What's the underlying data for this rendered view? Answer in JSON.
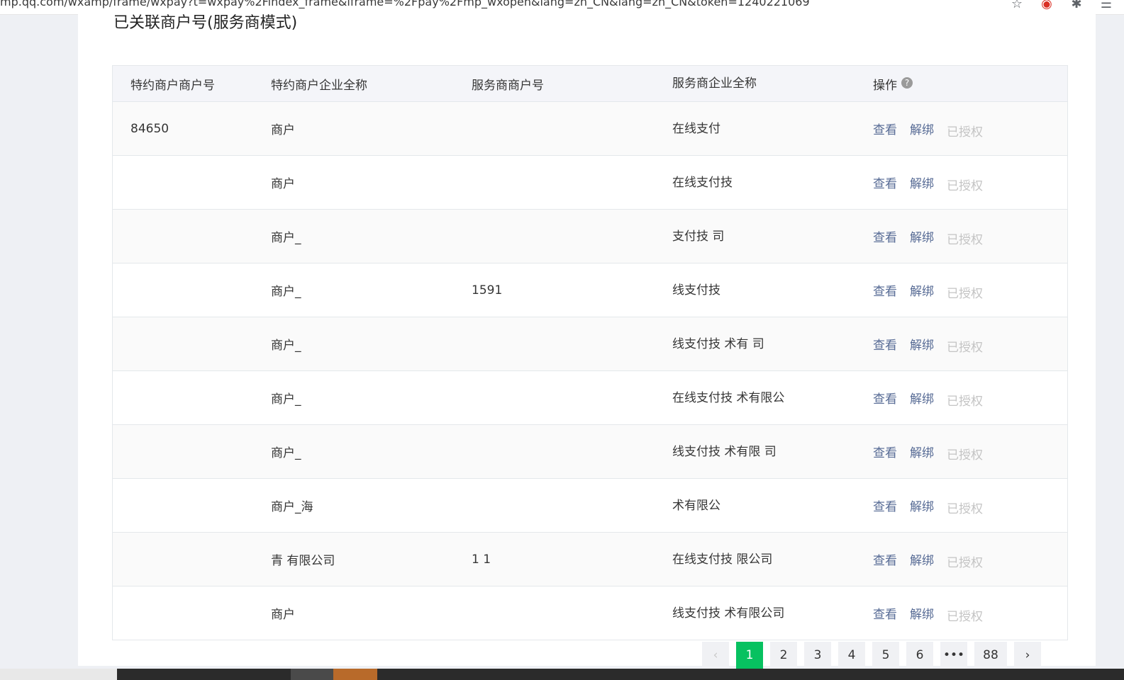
{
  "browser": {
    "url": "mp.qq.com/wxamp/frame/wxpay?t=wxpay%2Findex_frame&iframe=%2Fpay%2Fmp_wxopen&lang=zh_CN&lang=zh_CN&token=1240221069",
    "icons": [
      "star-icon",
      "record-icon",
      "extension-icon",
      "reading-list-icon"
    ]
  },
  "section": {
    "title": "已关联商户号(服务商模式)"
  },
  "table": {
    "headers": [
      "特约商户商户号",
      "特约商户企业全称",
      "服务商商户号",
      "服务商企业全称",
      "操作"
    ],
    "help_icon": "?",
    "rows": [
      {
        "merchant_id": "84650",
        "merchant_name": "商户",
        "provider_id": "",
        "provider_name": "在线支付"
      },
      {
        "merchant_id": "",
        "merchant_name": "商户",
        "provider_id": "",
        "provider_name": "在线支付技"
      },
      {
        "merchant_id": "",
        "merchant_name": "商户_",
        "provider_id": "",
        "provider_name": "支付技 司"
      },
      {
        "merchant_id": "",
        "merchant_name": "商户_",
        "provider_id": "1591",
        "provider_name": "线支付技"
      },
      {
        "merchant_id": "",
        "merchant_name": "商户_",
        "provider_id": "",
        "provider_name": "线支付技 术有 司"
      },
      {
        "merchant_id": "",
        "merchant_name": "商户_",
        "provider_id": "",
        "provider_name": "在线支付技 术有限公"
      },
      {
        "merchant_id": "",
        "merchant_name": "商户_",
        "provider_id": "",
        "provider_name": "线支付技 术有限 司"
      },
      {
        "merchant_id": "",
        "merchant_name": "商户_海",
        "provider_id": "",
        "provider_name": "术有限公"
      },
      {
        "merchant_id": "",
        "merchant_name": "青 有限公司",
        "provider_id": "1 1",
        "provider_name": "在线支付技 限公司"
      },
      {
        "merchant_id": "",
        "merchant_name": "商户",
        "provider_id": "",
        "provider_name": "线支付技 术有限公司"
      }
    ],
    "actions": {
      "view": "查看",
      "unbind": "解绑",
      "authorized": "已授权"
    }
  },
  "pagination": {
    "prev": "‹",
    "pages": [
      "1",
      "2",
      "3",
      "4",
      "5",
      "6"
    ],
    "ellipsis": "•••",
    "last": "88",
    "next": "›",
    "current": "1"
  },
  "colors": {
    "accent_green": "#07c160",
    "link": "#576b95",
    "disabled": "#c4c4c4",
    "header_bg": "#f4f5f9"
  }
}
